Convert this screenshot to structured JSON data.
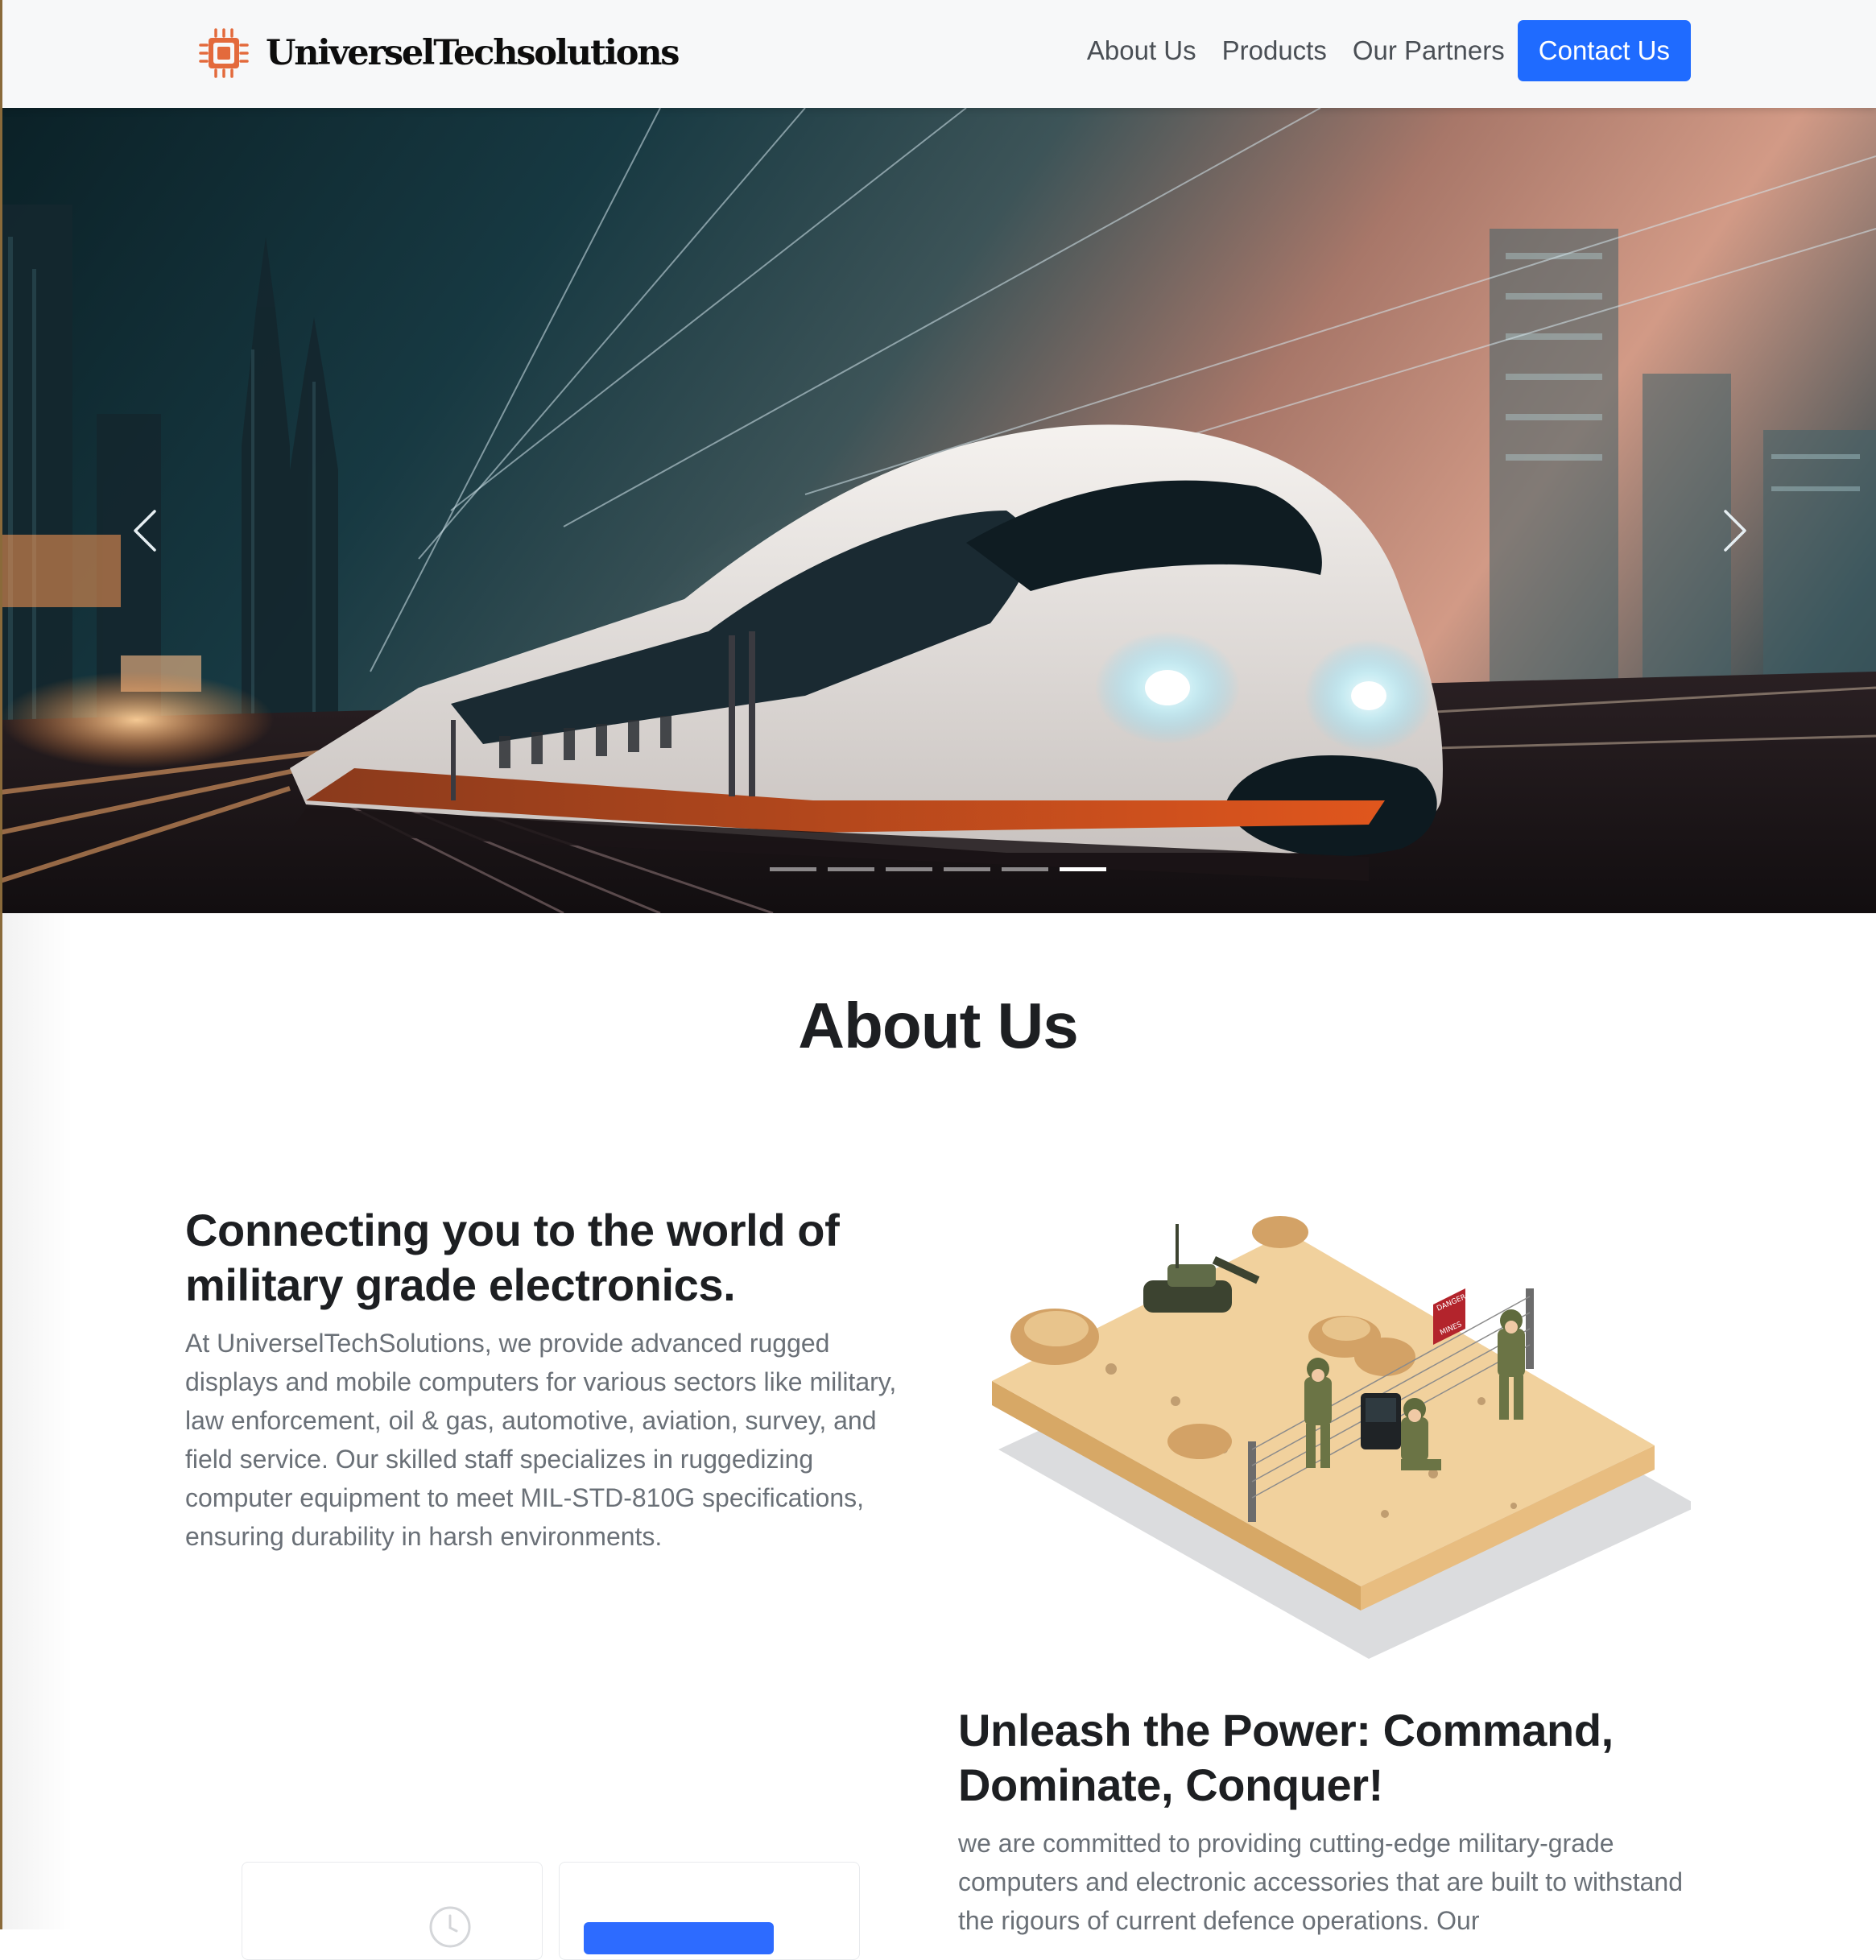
{
  "navbar": {
    "brand": "UniverselTechsolutions",
    "links": [
      "About Us",
      "Products",
      "Our Partners"
    ],
    "cta": "Contact Us",
    "brand_icon": "microchip-icon",
    "accent": "#1f6bff"
  },
  "carousel": {
    "slide_count": 6,
    "active_index": 5,
    "prev_icon": "chevron-left-icon",
    "next_icon": "chevron-right-icon"
  },
  "about": {
    "title": "About Us",
    "section1": {
      "heading": "Connecting you to the world of military grade electronics.",
      "text": "At UniverselTechSolutions, we provide advanced rugged displays and mobile computers for various sectors like military, law enforcement, oil & gas, automotive, aviation, survey, and field service. Our skilled staff specializes in ruggedizing computer equipment to meet MIL-STD-810G specifications, ensuring durability in harsh environments."
    },
    "section2": {
      "heading": "Unleash the Power: Command, Dominate, Conquer!",
      "text": "we are committed to providing cutting-edge military-grade computers and electronic accessories that are built to withstand the rigours of current defence operations. Our"
    },
    "illustration_sign": [
      "DANGER",
      "MINES"
    ]
  }
}
